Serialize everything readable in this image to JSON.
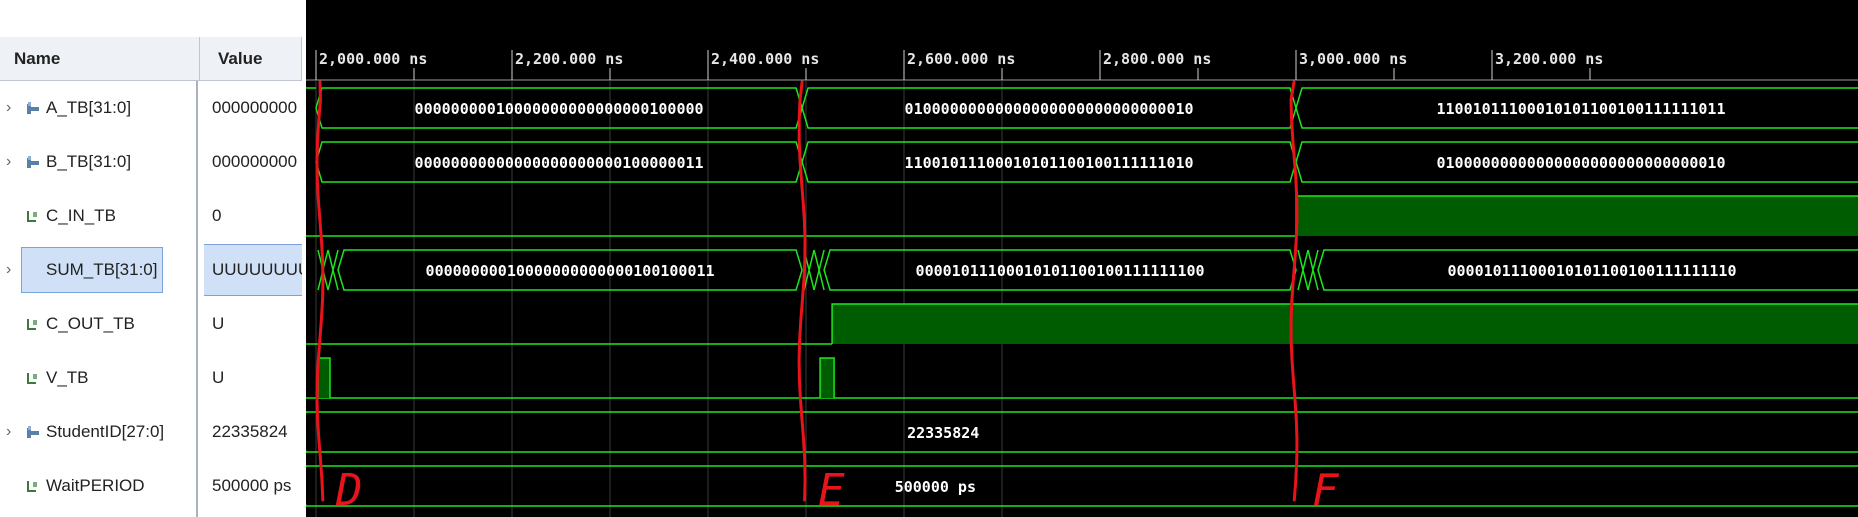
{
  "columns": {
    "name_label": "Name",
    "value_label": "Value"
  },
  "signals": [
    {
      "name": "A_TB[31:0]",
      "value": "000000000",
      "bus": true,
      "icon": "bus-signal-icon"
    },
    {
      "name": "B_TB[31:0]",
      "value": "000000000",
      "bus": true,
      "icon": "bus-signal-icon"
    },
    {
      "name": "C_IN_TB",
      "value": "0",
      "bus": false,
      "icon": "bit-signal-icon"
    },
    {
      "name": "SUM_TB[31:0]",
      "value": "UUUUUUUU",
      "bus": true,
      "icon": "bus-signal-icon",
      "selected": true
    },
    {
      "name": "C_OUT_TB",
      "value": "U",
      "bus": false,
      "icon": "bit-signal-icon"
    },
    {
      "name": "V_TB",
      "value": "U",
      "bus": false,
      "icon": "bit-signal-icon"
    },
    {
      "name": "StudentID[27:0]",
      "value": "22335824",
      "bus": true,
      "icon": "bus-signal-icon"
    },
    {
      "name": "WaitPERIOD",
      "value": "500000 ps",
      "bus": false,
      "icon": "bit-signal-icon"
    }
  ],
  "timeline": {
    "ticks": [
      "2,000.000 ns",
      "2,200.000 ns",
      "2,400.000 ns",
      "2,600.000 ns",
      "2,800.000 ns",
      "3,000.000 ns",
      "3,200.000 ns"
    ]
  },
  "bus_values": {
    "a_tb": [
      "00000000010000000000000000100000",
      "01000000000000000000000000000010",
      "11001011100010101100100111111011"
    ],
    "b_tb": [
      "00000000000000000000000100000011",
      "11001011100010101100100111111010",
      "01000000000000000000000000000010"
    ],
    "sum_tb": [
      "00000000010000000000000100100011",
      "00001011100010101100100111111100",
      "00001011100010101100100111111110"
    ],
    "student_id": "22335824",
    "wait_period": "500000 ps"
  },
  "annotations": [
    "D",
    "E",
    "F"
  ],
  "colors": {
    "wave_green": "#1ee61e",
    "high_fill": "#005c00",
    "grid": "#3a3a3a",
    "annotation_red": "#e8141a",
    "selected_bg": "#cfe0f7"
  }
}
